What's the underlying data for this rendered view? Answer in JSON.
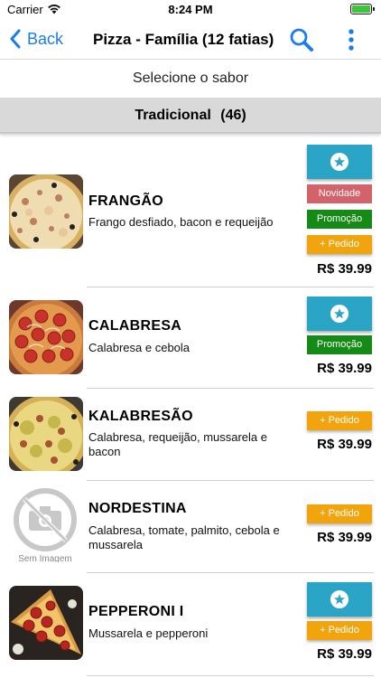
{
  "status_bar": {
    "carrier": "Carrier",
    "time": "8:24 PM"
  },
  "nav": {
    "back_label": "Back",
    "title": "Pizza - Família (12 fatias)"
  },
  "subtitle": "Selecione o sabor",
  "section": {
    "name": "Tradicional",
    "count": "(46)"
  },
  "colors": {
    "accent_blue": "#1a7cf0",
    "fav_button": "#2aa5c6",
    "badge_new": "#d4626b",
    "badge_promo": "#168a16",
    "badge_order": "#f2a40c"
  },
  "labels": {
    "no_image": "Sem Imagem"
  },
  "items": [
    {
      "name": "FRANGÃO",
      "description": "Frango desfiado, bacon e requeijão",
      "favorite": true,
      "new_label": "Novidade",
      "promo_label": "Promoção",
      "order_label": "+ Pedido",
      "price": "R$ 39.99"
    },
    {
      "name": "CALABRESA",
      "description": "Calabresa e cebola",
      "favorite": true,
      "promo_label": "Promoção",
      "price": "R$ 39.99"
    },
    {
      "name": "KALABRESÃO",
      "description": "Calabresa, requeijão, mussarela e bacon",
      "order_label": "+ Pedido",
      "price": "R$ 39.99"
    },
    {
      "name": "NORDESTINA",
      "description": "Calabresa, tomate, palmito, cebola e mussarela",
      "order_label": "+ Pedido",
      "price": "R$ 39.99"
    },
    {
      "name": "PEPPERONI I",
      "description": "Mussarela e pepperoni",
      "favorite": true,
      "order_label": "+ Pedido",
      "price": "R$ 39.99"
    }
  ]
}
